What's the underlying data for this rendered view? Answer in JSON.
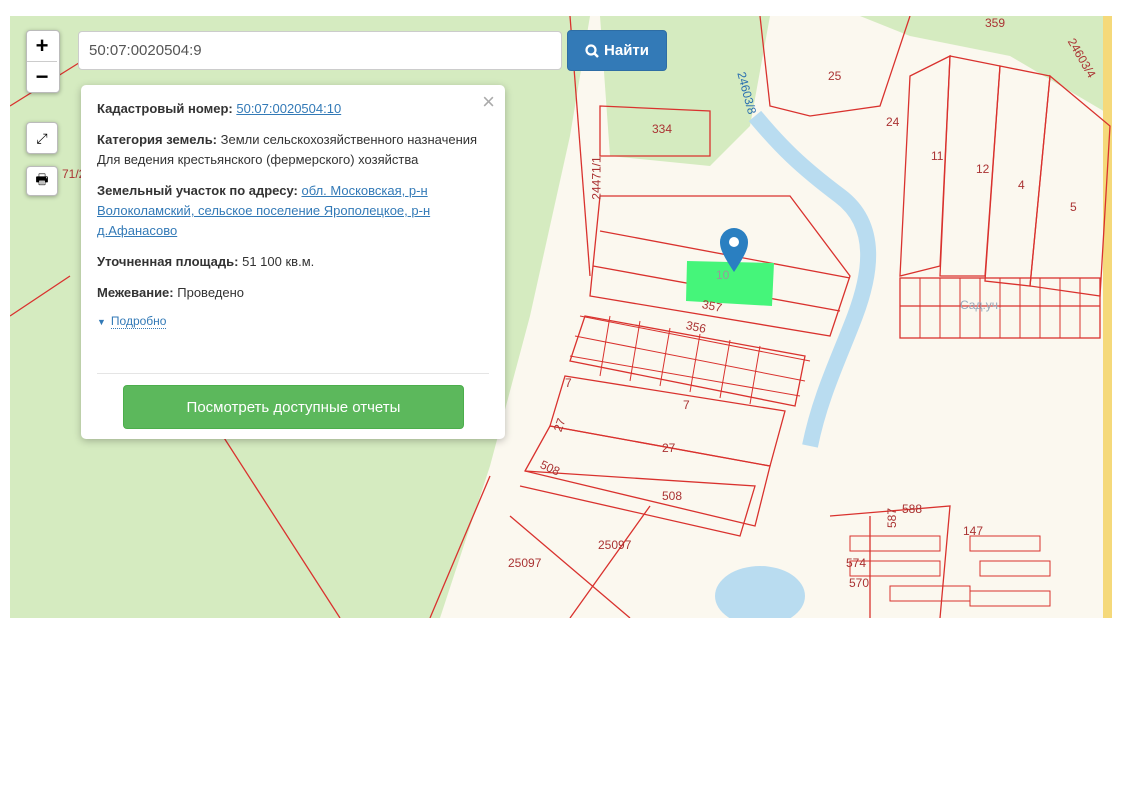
{
  "search": {
    "value": "50:07:0020504:9",
    "button_label": "Найти",
    "icon": "search-icon"
  },
  "controls": {
    "zoom_in": "+",
    "zoom_out": "−",
    "fullscreen_icon": "expand-icon",
    "print_icon": "print-icon"
  },
  "popup": {
    "cad_label": "Кадастровый номер:",
    "cad_value": "50:07:0020504:10",
    "cat_label": "Категория земель:",
    "cat_value": "Земли сельскохозяйственного назначения",
    "use_value": "Для ведения крестьянского (фермерского) хозяйства",
    "addr_label": "Земельный участок по адресу:",
    "addr_value": "обл. Московская, р-н Волоколамский, сельское поселение Ярополецкое, р-н д.Афанасово",
    "area_label": "Уточненная площадь:",
    "area_value": "51 100 кв.м.",
    "survey_label": "Межевание:",
    "survey_value": "Проведено",
    "more_label": "Подробно",
    "reports_button": "Посмотреть доступные отчеты",
    "close": "×"
  },
  "map_labels": [
    "334",
    "25",
    "24",
    "11",
    "12",
    "4",
    "5",
    "359",
    "24603/4",
    "24603/8",
    "24471/1",
    "10",
    "357",
    "356",
    "7",
    "7",
    "27",
    "27",
    "508",
    "508",
    "25097",
    "25097",
    "574",
    "570",
    "587",
    "588",
    "147",
    "71/2",
    "Сад.уч."
  ],
  "colors": {
    "forest": "#d5ebc0",
    "land": "#fbf8ef",
    "water": "#b9dcf0",
    "parcel_line": "#d9322e",
    "selected": "#45f57a",
    "accent": "#337ab7",
    "green_btn": "#5cb85c"
  }
}
